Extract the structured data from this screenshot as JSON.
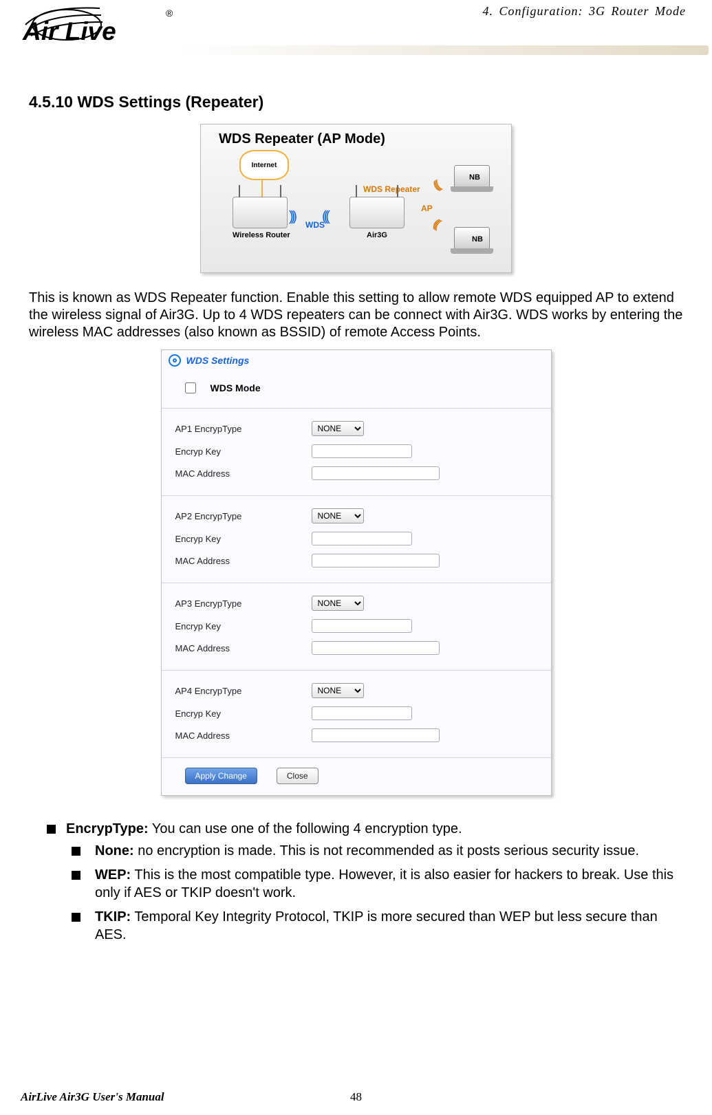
{
  "header": {
    "brand": "Air Live",
    "brand_registered": "®",
    "chapter": "4. Configuration: 3G Router Mode"
  },
  "section_heading": "4.5.10 WDS Settings (Repeater)",
  "diagram1": {
    "title": "WDS Repeater (AP Mode)",
    "internet": "Internet",
    "wds": "WDS",
    "wds_repeater": "WDS Repeater",
    "ap": "AP",
    "wireless_router": "Wireless Router",
    "air3g": "Air3G",
    "nb": "NB"
  },
  "paragraph": "This is known as WDS Repeater function.   Enable this setting to allow remote WDS equipped AP to extend the wireless signal of Air3G.   Up to 4 WDS repeaters can be connect with Air3G.   WDS works by entering the wireless MAC addresses (also known as BSSID) of remote Access Points.",
  "panel": {
    "title": "WDS Settings",
    "wds_mode_label": "WDS Mode",
    "wds_mode_checked": false,
    "encryp_type_label": "EncrypType",
    "encryp_key_label": "Encryp Key",
    "mac_label": "MAC Address",
    "select_value": "NONE",
    "aps": [
      {
        "ap_label": "AP1",
        "encryp_type": "NONE",
        "encryp_key": "",
        "mac": ""
      },
      {
        "ap_label": "AP2",
        "encryp_type": "NONE",
        "encryp_key": "",
        "mac": ""
      },
      {
        "ap_label": "AP3",
        "encryp_type": "NONE",
        "encryp_key": "",
        "mac": ""
      },
      {
        "ap_label": "AP4",
        "encryp_type": "NONE",
        "encryp_key": "",
        "mac": ""
      }
    ],
    "apply_button": "Apply Change",
    "close_button": "Close"
  },
  "bullets": {
    "encryp_type_title": "EncrypType:",
    "encryp_type_text": " You can use one of the following 4 encryption type.",
    "none_title": "None:",
    "none_text": " no encryption is made.   This is not recommended as it posts serious security issue.",
    "wep_title": "WEP:",
    "wep_text": " This is the most compatible type.   However, it is also easier for hackers to break.   Use this only if AES or TKIP doesn't work.",
    "tkip_title": "TKIP:",
    "tkip_text": " Temporal Key Integrity Protocol, TKIP is more secured than WEP but less secure than AES."
  },
  "footer": {
    "manual": "AirLive Air3G User's Manual",
    "page": "48"
  }
}
